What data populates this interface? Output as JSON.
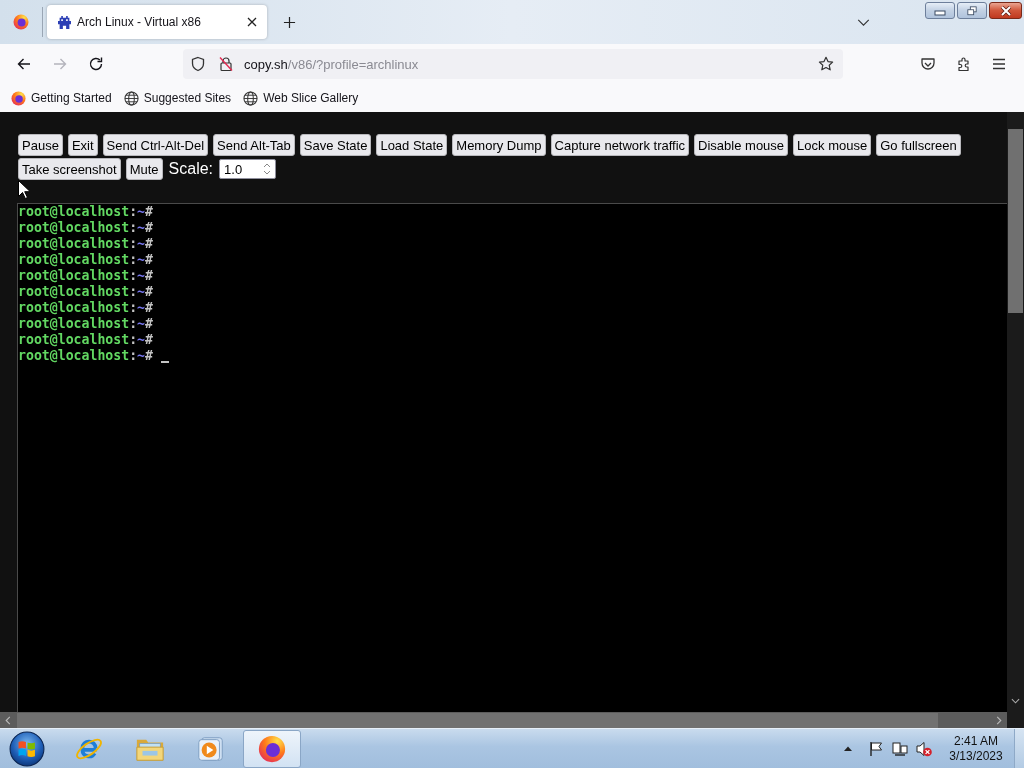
{
  "browser": {
    "tabs": [
      {
        "title": "Arch Linux - Virtual x86",
        "selected": true
      }
    ],
    "nav_buttons": [
      {
        "kind": "back",
        "disabled": false
      },
      {
        "kind": "forward",
        "disabled": true
      },
      {
        "kind": "reload",
        "disabled": false
      }
    ],
    "address_bar": {
      "host": "copy.sh",
      "path": "/v86/?profile=archlinux"
    },
    "bookmarks": [
      {
        "label": "Getting Started",
        "kind": "fox"
      },
      {
        "label": "Suggested Sites",
        "kind": "globe"
      },
      {
        "label": "Web Slice Gallery",
        "kind": "globe"
      }
    ]
  },
  "page": {
    "buttons": [
      "Pause",
      "Exit",
      "Send Ctrl-Alt-Del",
      "Send Alt-Tab",
      "Save State",
      "Load State",
      "Memory Dump",
      "Capture network traffic",
      "Disable mouse",
      "Lock mouse",
      "Go fullscreen",
      "Take screenshot",
      "Mute"
    ],
    "scale": {
      "label": "Scale:",
      "value": "1.0"
    },
    "terminal": {
      "lines": [
        {
          "user_host": "root@localhost",
          "separator": ":",
          "path": "~",
          "prompt": "#",
          "cursor": false
        },
        {
          "user_host": "root@localhost",
          "separator": ":",
          "path": "~",
          "prompt": "#",
          "cursor": false
        },
        {
          "user_host": "root@localhost",
          "separator": ":",
          "path": "~",
          "prompt": "#",
          "cursor": false
        },
        {
          "user_host": "root@localhost",
          "separator": ":",
          "path": "~",
          "prompt": "#",
          "cursor": false
        },
        {
          "user_host": "root@localhost",
          "separator": ":",
          "path": "~",
          "prompt": "#",
          "cursor": false
        },
        {
          "user_host": "root@localhost",
          "separator": ":",
          "path": "~",
          "prompt": "#",
          "cursor": false
        },
        {
          "user_host": "root@localhost",
          "separator": ":",
          "path": "~",
          "prompt": "#",
          "cursor": false
        },
        {
          "user_host": "root@localhost",
          "separator": ":",
          "path": "~",
          "prompt": "#",
          "cursor": false
        },
        {
          "user_host": "root@localhost",
          "separator": ":",
          "path": "~",
          "prompt": "#",
          "cursor": false
        },
        {
          "user_host": "root@localhost",
          "separator": ":",
          "path": "~",
          "prompt": "#",
          "cursor": true
        }
      ]
    }
  },
  "taskbar": {
    "apps": [
      {
        "kind": "e",
        "selected": false
      },
      {
        "kind": "folder",
        "selected": false
      },
      {
        "kind": "play",
        "selected": false
      },
      {
        "kind": "fox",
        "selected": true
      }
    ],
    "clock": {
      "time": "2:41 AM",
      "date": "3/13/2023"
    }
  }
}
